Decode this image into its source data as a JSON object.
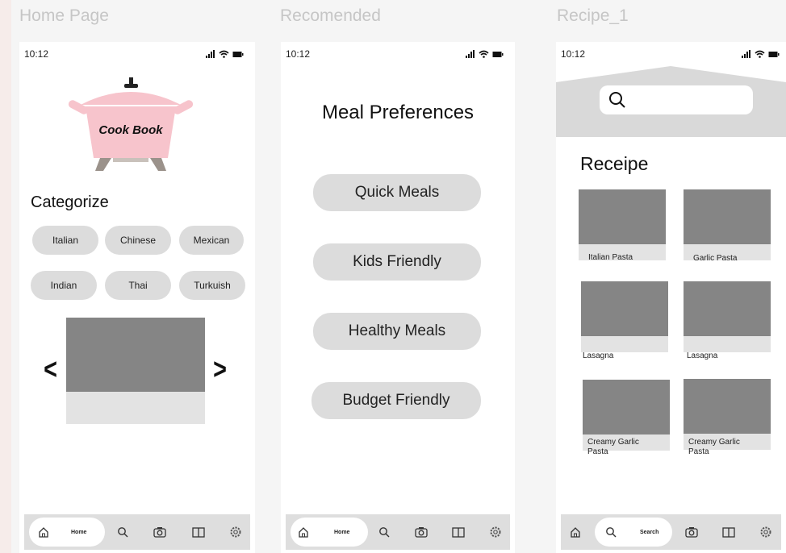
{
  "frames": [
    {
      "label": "Home Page",
      "time": "10:12"
    },
    {
      "label": "Recomended",
      "time": "10:12"
    },
    {
      "label": "Recipe_1",
      "time": "10:12"
    }
  ],
  "home": {
    "logo_text": "Cook Book",
    "section_title": "Categorize",
    "categories": [
      "Italian",
      "Chinese",
      "Mexican",
      "Indian",
      "Thai",
      "Turkuish"
    ],
    "carousel_prev": "<",
    "carousel_next": ">"
  },
  "recommended": {
    "title": "Meal Preferences",
    "options": [
      "Quick Meals",
      "Kids Friendly",
      "Healthy Meals",
      "Budget Friendly"
    ]
  },
  "recipe": {
    "title": "Receipe",
    "recipes": [
      "Italian Pasta",
      "Garlic Pasta",
      "Lasagna",
      "Lasagna",
      "Creamy Garlic Pasta",
      "Creamy Garlic Pasta"
    ]
  },
  "tabbar": {
    "home_label": "Home",
    "search_label": "Search",
    "icons": [
      "home-icon",
      "search-icon",
      "camera-icon",
      "book-icon",
      "settings-icon"
    ]
  },
  "colors": {
    "pot": "#f7c4cc",
    "pill": "#dcdcdc",
    "placeholder": "#858585",
    "tabbar": "#dedede"
  }
}
